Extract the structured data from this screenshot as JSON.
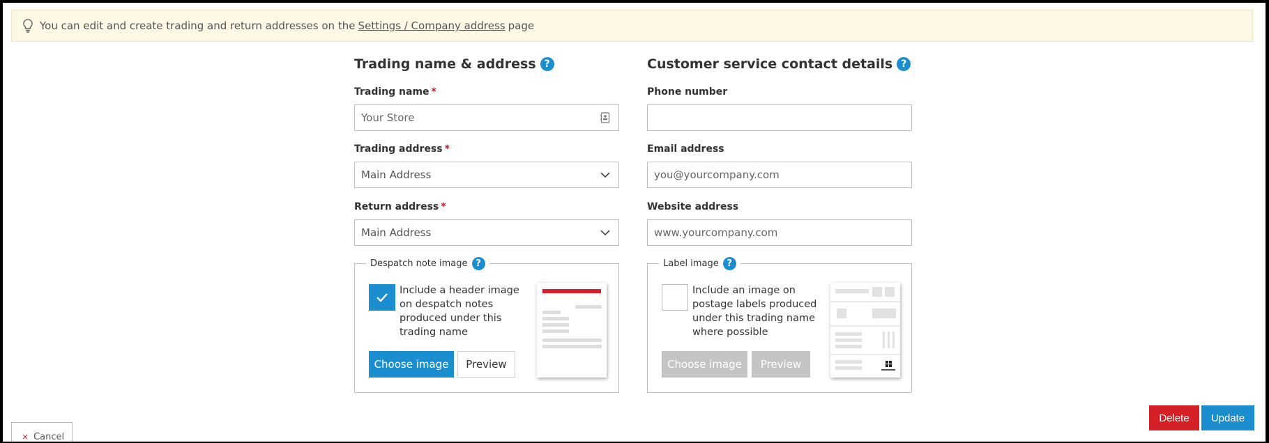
{
  "notice": {
    "text_before": "You can edit and create trading and return addresses on the",
    "link": "Settings / Company address",
    "text_after": "page",
    "icon": "lightbulb-icon"
  },
  "trading": {
    "title": "Trading name & address",
    "trading_name": {
      "label": "Trading name",
      "required": "*",
      "placeholder": "Your Store"
    },
    "trading_address": {
      "label": "Trading address",
      "required": "*",
      "value": "Main Address"
    },
    "return_address": {
      "label": "Return address",
      "required": "*",
      "value": "Main Address"
    },
    "despatch": {
      "legend": "Despatch note image",
      "checked": true,
      "text": "Include a header image on despatch notes produced under this trading name",
      "choose_label": "Choose image",
      "preview_label": "Preview"
    }
  },
  "customer_service": {
    "title": "Customer service contact details",
    "phone": {
      "label": "Phone number",
      "placeholder": ""
    },
    "email": {
      "label": "Email address",
      "placeholder": "you@yourcompany.com"
    },
    "website": {
      "label": "Website address",
      "placeholder": "www.yourcompany.com"
    },
    "label_image": {
      "legend": "Label image",
      "checked": false,
      "text": "Include an image on postage labels produced under this trading name where possible",
      "choose_label": "Choose image",
      "preview_label": "Preview"
    }
  },
  "help_symbol": "?",
  "actions": {
    "delete": "Delete",
    "update": "Update",
    "cancel": "Cancel",
    "cancel_symbol": "×"
  },
  "colors": {
    "primary": "#1a8ecf",
    "danger": "#d52027",
    "notice_bg": "#fdf8e6",
    "disabled": "#c3c4c5"
  }
}
